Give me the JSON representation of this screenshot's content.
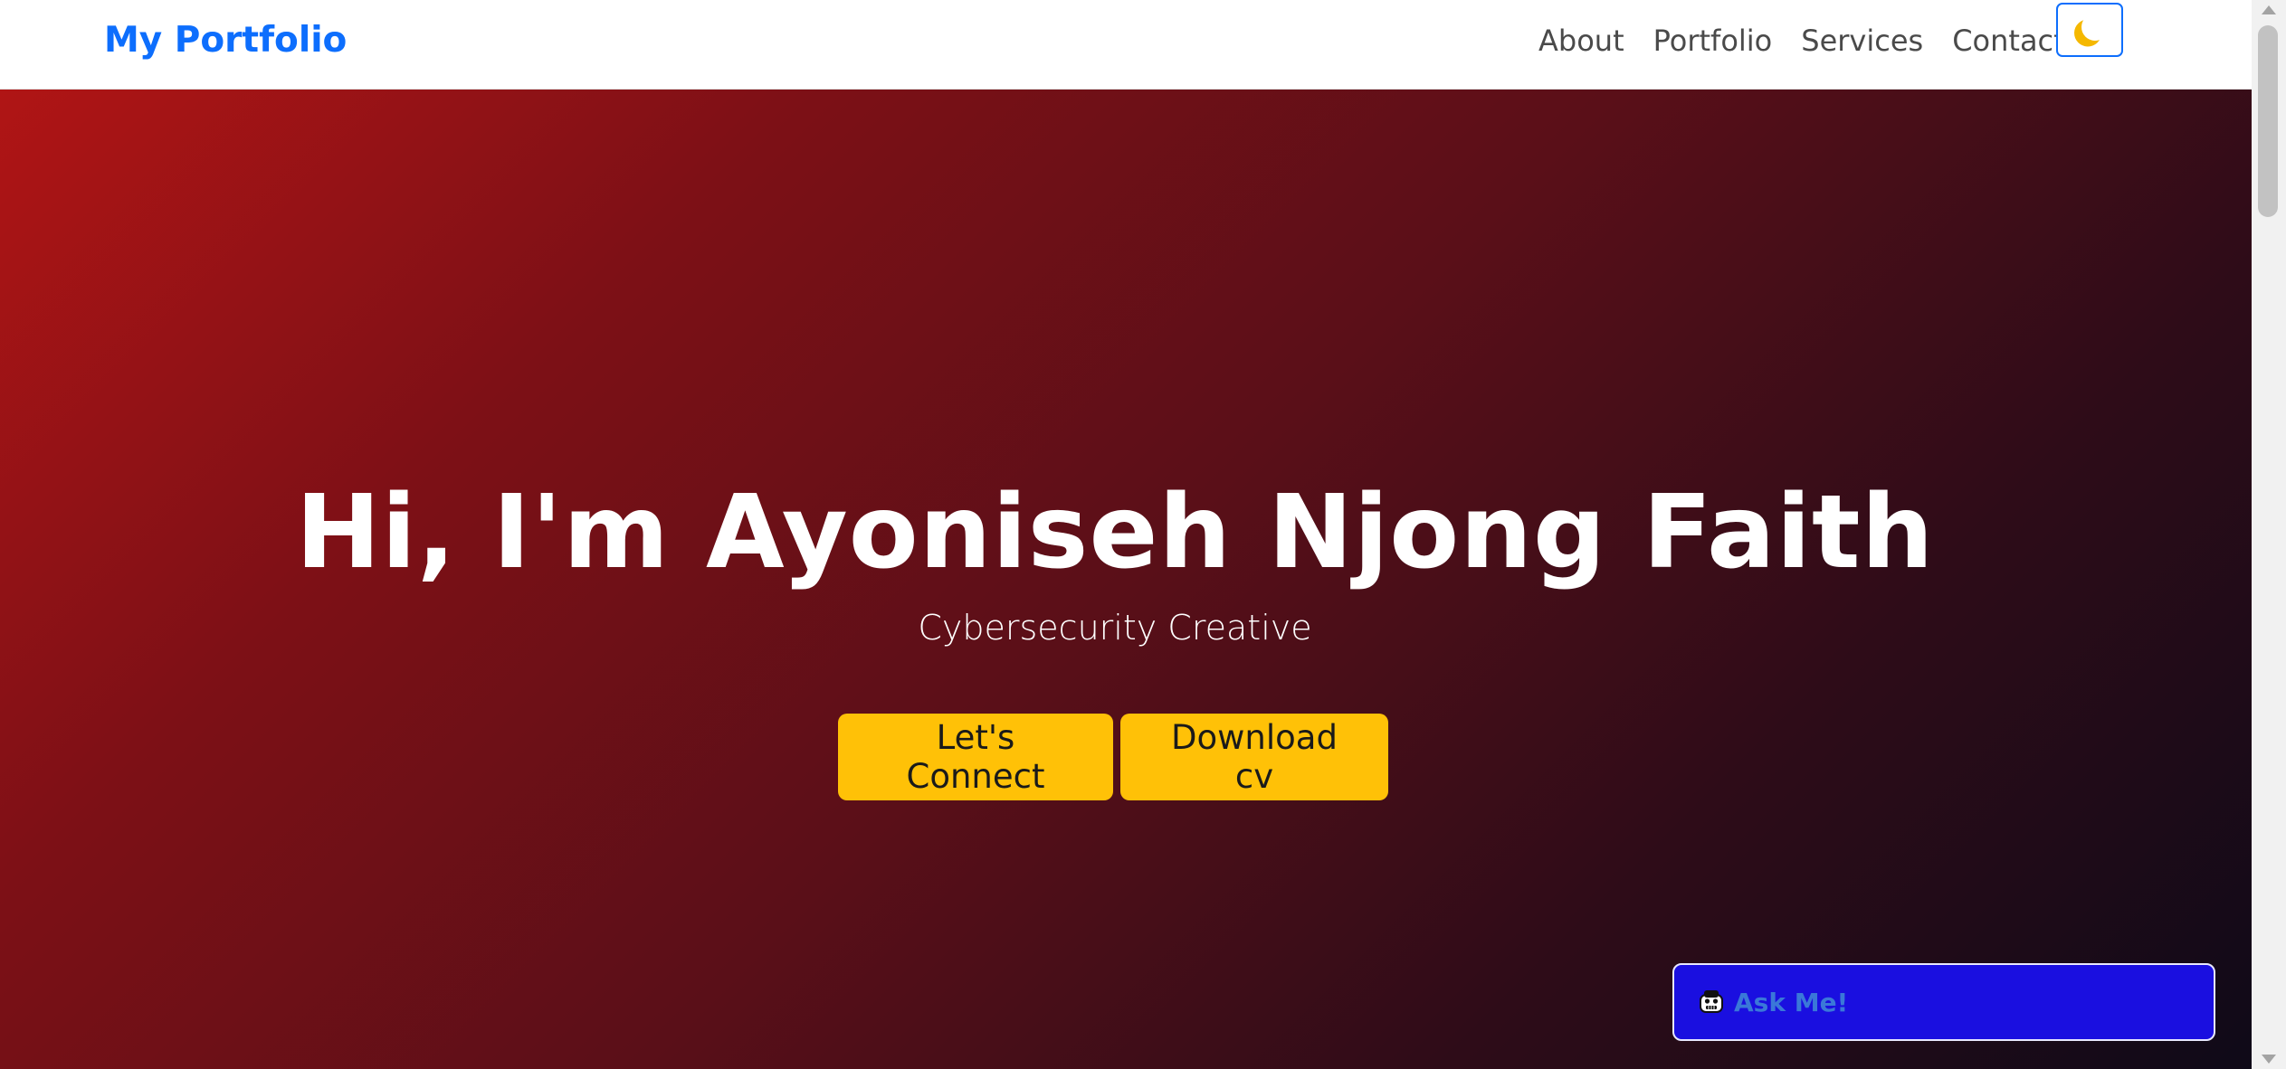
{
  "navbar": {
    "brand": "My Portfolio",
    "links": [
      {
        "label": "About"
      },
      {
        "label": "Portfolio"
      },
      {
        "label": "Services"
      },
      {
        "label": "Contact"
      }
    ],
    "theme_toggle_icon": "moon-icon"
  },
  "hero": {
    "title": "Hi, I'm Ayoniseh Njong Faith",
    "subtitle": "Cybersecurity Creative",
    "buttons": {
      "connect_label": "Let's Connect",
      "cv_label": "Download cv"
    }
  },
  "chat_widget": {
    "label": "Ask Me!",
    "icon": "robot-icon"
  },
  "colors": {
    "brand": "#0d6efd",
    "button_accent": "#ffc107",
    "chat_widget_bg": "#1a0fe0",
    "hero_gradient_start": "#b01515",
    "hero_gradient_end": "#0f0a18"
  }
}
